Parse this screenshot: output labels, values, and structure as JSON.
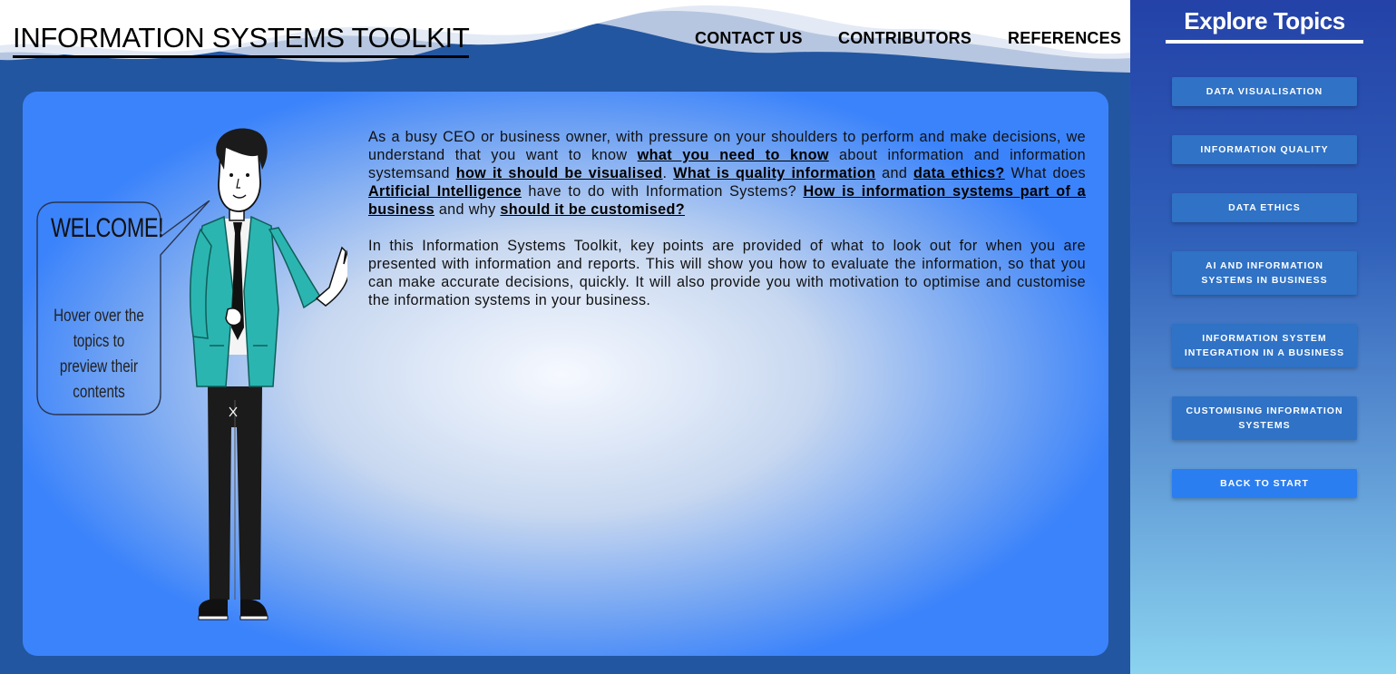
{
  "header": {
    "title": "INFORMATION SYSTEMS TOOLKIT",
    "nav": [
      "CONTACT US",
      "CONTRIBUTORS",
      "REFERENCES"
    ]
  },
  "main": {
    "paragraphs": [
      [
        {
          "t": "As a busy CEO or business owner, with pressure on your shoulders to perform and make decisions, we understand that you want to know "
        },
        {
          "t": "what you need to know",
          "link": true
        },
        {
          "t": " about information and information systemsand "
        },
        {
          "t": "how it should be visualised",
          "link": true
        },
        {
          "t": ". "
        },
        {
          "t": "What is quality information",
          "link": true
        },
        {
          "t": " and "
        },
        {
          "t": "data ethics?",
          "link": true
        },
        {
          "t": " What does "
        },
        {
          "t": "Artificial Intelligence",
          "link": true
        },
        {
          "t": " have to do with Information Systems? "
        },
        {
          "t": "How is information systems part of a business",
          "link": true
        },
        {
          "t": " and why "
        },
        {
          "t": "should it be customised?",
          "link": true
        }
      ],
      [
        {
          "t": "In this Information Systems Toolkit, key points are provided of what to look out for when you are presented with information and reports. This will show you how to evaluate the information, so that you can make accurate decisions, quickly. It will also provide you with motivation to optimise and customise the information systems in your business."
        }
      ]
    ],
    "bubble": {
      "title": "WELCOME!",
      "text": "Hover over the topics to preview their contents"
    }
  },
  "sidebar": {
    "title": "Explore Topics",
    "topics": [
      "DATA VISUALISATION",
      "INFORMATION QUALITY",
      "DATA ETHICS",
      "AI AND INFORMATION SYSTEMS IN BUSINESS",
      "INFORMATION SYSTEM INTEGRATION IN A BUSINESS",
      "CUSTOMISING INFORMATION SYSTEMS",
      "BACK TO START"
    ]
  },
  "colors": {
    "page_bg": "#2356a0",
    "topic_button": "#2f72c6",
    "back_button": "#2b7ef0",
    "character_jacket": "#2bb5b0"
  }
}
